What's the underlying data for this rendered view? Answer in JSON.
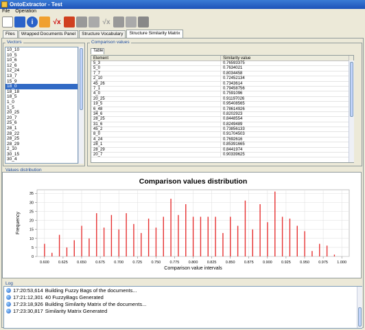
{
  "window": {
    "title": "OntoExtractor - Test"
  },
  "menu": {
    "items": [
      "File",
      "Operation"
    ]
  },
  "toolbar": {
    "icons": [
      "new-document-icon",
      "open-folder-icon",
      "info-icon",
      "extract-icon",
      "fx-icon",
      "puzzle-icon",
      "gray-puzzle-icon",
      "gray-puzzle-icon",
      "gray-fx-icon",
      "gray-puzzle-icon",
      "gray-puzzle-icon",
      "gray-image-icon"
    ]
  },
  "tabs": [
    "Files",
    "Wrapped Documents Panel",
    "Structure Vocabulary",
    "Structure Similarity Matrix"
  ],
  "vectors": {
    "title": "Vectors",
    "items": [
      "10_10",
      "10_5",
      "10_6",
      "12_6",
      "12_24",
      "13_7",
      "15_9",
      "18_0",
      "18_18",
      "18_5",
      "1_0",
      "1_5",
      "20_25",
      "20_7",
      "25_6",
      "28_1",
      "28_22",
      "28_25",
      "28_29",
      "2_10",
      "30_15",
      "30_4"
    ],
    "selected": "18_0"
  },
  "comparison": {
    "title": "Comparison values",
    "tab": "Table",
    "columns": [
      "Element",
      "Similarity value"
    ],
    "rows": [
      [
        "5_3",
        "0.76593375"
      ],
      [
        "5_0",
        "0.7634021"
      ],
      [
        "7_7",
        "0.8034458"
      ],
      [
        "2_10",
        "0.72452134"
      ],
      [
        "45_26",
        "0.7343614"
      ],
      [
        "7_1",
        "0.79458756"
      ],
      [
        "4_0",
        "0.7591096"
      ],
      [
        "20_25",
        "0.91197026"
      ],
      [
        "19_5",
        "0.95408565"
      ],
      [
        "6_48",
        "0.78614926"
      ],
      [
        "34_6",
        "0.8202923"
      ],
      [
        "28_25",
        "0.8448554"
      ],
      [
        "31_6",
        "0.8249489"
      ],
      [
        "45_2",
        "0.73856133"
      ],
      [
        "8_0",
        "0.91704503"
      ],
      [
        "4_24",
        "0.7692616"
      ],
      [
        "28_1",
        "0.85391665"
      ],
      [
        "28_29",
        "0.8441974"
      ],
      [
        "20_7",
        "0.90339625"
      ]
    ]
  },
  "distribution": {
    "title": "Values distribution"
  },
  "chart_data": {
    "type": "bar",
    "title": "Comparison values distribution",
    "xlabel": "Comparison value intervals",
    "ylabel": "Frequency",
    "xlim": [
      0.59,
      1.01
    ],
    "ylim": [
      0,
      37
    ],
    "xticks": [
      0.6,
      0.625,
      0.65,
      0.675,
      0.7,
      0.725,
      0.75,
      0.775,
      0.8,
      0.825,
      0.85,
      0.875,
      0.9,
      0.925,
      0.95,
      0.975,
      1.0
    ],
    "xtick_labels": [
      "0.600",
      "0.625",
      "0.650",
      "0.675",
      "0.700",
      "0.725",
      "0.750",
      "0.775",
      "0.800",
      "0.825",
      "0.850",
      "0.875",
      "0.900",
      "0.925",
      "0.950",
      "0.975",
      "1.000"
    ],
    "yticks": [
      0,
      5,
      10,
      15,
      20,
      25,
      30,
      35
    ],
    "x": [
      0.6,
      0.61,
      0.62,
      0.63,
      0.64,
      0.65,
      0.66,
      0.67,
      0.68,
      0.69,
      0.7,
      0.71,
      0.72,
      0.73,
      0.74,
      0.75,
      0.76,
      0.77,
      0.78,
      0.79,
      0.8,
      0.81,
      0.82,
      0.83,
      0.84,
      0.85,
      0.86,
      0.87,
      0.88,
      0.89,
      0.9,
      0.91,
      0.92,
      0.93,
      0.94,
      0.95,
      0.96,
      0.97,
      0.98,
      0.99
    ],
    "values": [
      7,
      2,
      12,
      5,
      9,
      17,
      10,
      24,
      16,
      23,
      15,
      24,
      18,
      13,
      21,
      16,
      22,
      32,
      23,
      29,
      22,
      22,
      22,
      22,
      13,
      22,
      17,
      31,
      15,
      29,
      19,
      36,
      22,
      21,
      17,
      14,
      3,
      7,
      6,
      1
    ],
    "color": "#e63030"
  },
  "log": {
    "title": "Log",
    "entries": [
      {
        "time": "17:20:53,614",
        "msg": "Building Fuzzy Bags of the documents..."
      },
      {
        "time": "17:21:12,301",
        "msg": "40 FuzzyBags Generated"
      },
      {
        "time": "17:23:18,926",
        "msg": "Building Similarity Matrix of the documents..."
      },
      {
        "time": "17:23:30,817",
        "msg": "Similarity Matrix Generated"
      }
    ]
  }
}
